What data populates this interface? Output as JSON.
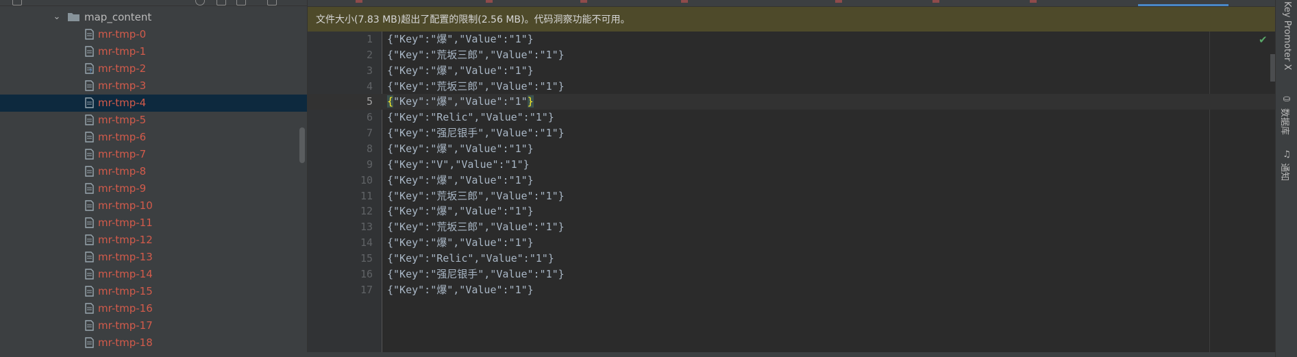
{
  "sidebar": {
    "folder": {
      "name": "map_content",
      "expanded": true
    },
    "files": [
      {
        "name": "mr-tmp-0",
        "selected": false,
        "icon": "file-icon"
      },
      {
        "name": "mr-tmp-1",
        "selected": false,
        "icon": "file-icon"
      },
      {
        "name": "mr-tmp-2",
        "selected": false,
        "icon": "unknown-file-icon"
      },
      {
        "name": "mr-tmp-3",
        "selected": false,
        "icon": "file-icon"
      },
      {
        "name": "mr-tmp-4",
        "selected": true,
        "icon": "file-icon"
      },
      {
        "name": "mr-tmp-5",
        "selected": false,
        "icon": "file-icon"
      },
      {
        "name": "mr-tmp-6",
        "selected": false,
        "icon": "file-icon"
      },
      {
        "name": "mr-tmp-7",
        "selected": false,
        "icon": "file-icon"
      },
      {
        "name": "mr-tmp-8",
        "selected": false,
        "icon": "file-icon"
      },
      {
        "name": "mr-tmp-9",
        "selected": false,
        "icon": "file-icon"
      },
      {
        "name": "mr-tmp-10",
        "selected": false,
        "icon": "file-icon"
      },
      {
        "name": "mr-tmp-11",
        "selected": false,
        "icon": "file-icon"
      },
      {
        "name": "mr-tmp-12",
        "selected": false,
        "icon": "file-icon"
      },
      {
        "name": "mr-tmp-13",
        "selected": false,
        "icon": "file-icon"
      },
      {
        "name": "mr-tmp-14",
        "selected": false,
        "icon": "file-icon"
      },
      {
        "name": "mr-tmp-15",
        "selected": false,
        "icon": "file-icon"
      },
      {
        "name": "mr-tmp-16",
        "selected": false,
        "icon": "file-icon"
      },
      {
        "name": "mr-tmp-17",
        "selected": false,
        "icon": "file-icon"
      },
      {
        "name": "mr-tmp-18",
        "selected": false,
        "icon": "file-icon"
      }
    ]
  },
  "editor": {
    "banner": "文件大小(7.83 MB)超出了配置的限制(2.56 MB)。代码洞察功能不可用。",
    "current_line": 5,
    "lines": [
      {
        "num": "1",
        "text": "{\"Key\":\"爆\",\"Value\":\"1\"}"
      },
      {
        "num": "2",
        "text": "{\"Key\":\"荒坂三郎\",\"Value\":\"1\"}"
      },
      {
        "num": "3",
        "text": "{\"Key\":\"爆\",\"Value\":\"1\"}"
      },
      {
        "num": "4",
        "text": "{\"Key\":\"荒坂三郎\",\"Value\":\"1\"}"
      },
      {
        "num": "5",
        "text": "{\"Key\":\"爆\",\"Value\":\"1\"}"
      },
      {
        "num": "6",
        "text": "{\"Key\":\"Relic\",\"Value\":\"1\"}"
      },
      {
        "num": "7",
        "text": "{\"Key\":\"强尼银手\",\"Value\":\"1\"}"
      },
      {
        "num": "8",
        "text": "{\"Key\":\"爆\",\"Value\":\"1\"}"
      },
      {
        "num": "9",
        "text": "{\"Key\":\"V\",\"Value\":\"1\"}"
      },
      {
        "num": "10",
        "text": "{\"Key\":\"爆\",\"Value\":\"1\"}"
      },
      {
        "num": "11",
        "text": "{\"Key\":\"荒坂三郎\",\"Value\":\"1\"}"
      },
      {
        "num": "12",
        "text": "{\"Key\":\"爆\",\"Value\":\"1\"}"
      },
      {
        "num": "13",
        "text": "{\"Key\":\"荒坂三郎\",\"Value\":\"1\"}"
      },
      {
        "num": "14",
        "text": "{\"Key\":\"爆\",\"Value\":\"1\"}"
      },
      {
        "num": "15",
        "text": "{\"Key\":\"Relic\",\"Value\":\"1\"}"
      },
      {
        "num": "16",
        "text": "{\"Key\":\"强尼银手\",\"Value\":\"1\"}"
      },
      {
        "num": "17",
        "text": "{\"Key\":\"爆\",\"Value\":\"1\"}"
      }
    ],
    "status_icon": "check-icon"
  },
  "right_strip": {
    "items": [
      {
        "label": "Key Promoter X",
        "icon": ""
      },
      {
        "label": "数据库",
        "icon": "database-icon"
      },
      {
        "label": "通知",
        "icon": "bell-icon"
      }
    ]
  },
  "colors": {
    "sidebar_bg": "#3c3f41",
    "editor_bg": "#2b2b2b",
    "selected_row": "#0d293e",
    "untracked_file": "#d35b4b",
    "banner_bg": "#4e4a2a",
    "brace_highlight": "#ffef28"
  }
}
